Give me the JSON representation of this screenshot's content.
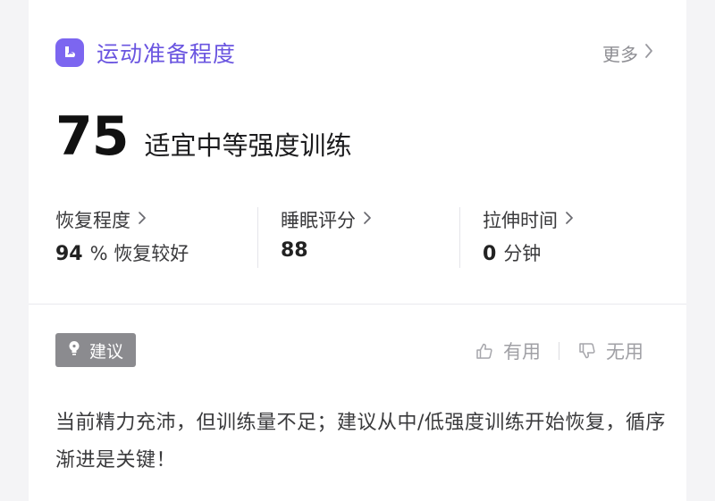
{
  "header": {
    "title": "运动准备程度",
    "more_label": "更多",
    "icon": "flexed-arm-icon",
    "accent_color": "#7c66f0"
  },
  "score": {
    "value": "75",
    "description": "适宜中等强度训练"
  },
  "metrics": [
    {
      "title": "恢复程度",
      "value": "94",
      "unit": "% 恢复较好"
    },
    {
      "title": "睡眠评分",
      "value": "88",
      "unit": ""
    },
    {
      "title": "拉伸时间",
      "value": "0",
      "unit": "分钟"
    }
  ],
  "advice": {
    "tag_label": "建议",
    "tag_icon": "lightbulb-icon",
    "helpful_label": "有用",
    "unhelpful_label": "无用",
    "text": "当前精力充沛，但训练量不足；建议从中/低强度训练开始恢复，循序渐进是关键！"
  }
}
